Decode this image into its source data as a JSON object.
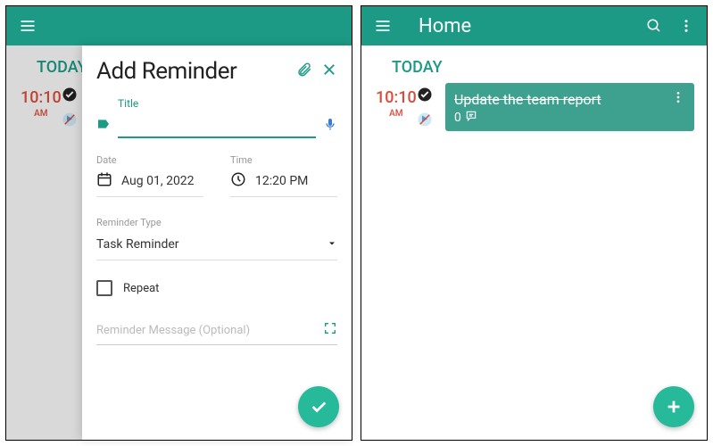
{
  "colors": {
    "accent": "#1C9A85",
    "fab": "#26B99A",
    "danger": "#d94a3a"
  },
  "left": {
    "background": {
      "today_label": "TODAY",
      "time": "10:10",
      "ampm": "AM"
    },
    "modal": {
      "title": "Add Reminder",
      "title_section_label": "Title",
      "title_input_value": "",
      "date_label": "Date",
      "date_value": "Aug 01, 2022",
      "time_label": "Time",
      "time_value": "12:20 PM",
      "type_label": "Reminder Type",
      "type_value": "Task Reminder",
      "repeat_label": "Repeat",
      "repeat_checked": false,
      "message_placeholder": "Reminder Message (Optional)"
    }
  },
  "right": {
    "appbar_title": "Home",
    "today_label": "TODAY",
    "time": "10:10",
    "ampm": "AM",
    "task": {
      "title": "Update the team report",
      "count": "0",
      "completed": true,
      "alarm_off": true
    }
  }
}
